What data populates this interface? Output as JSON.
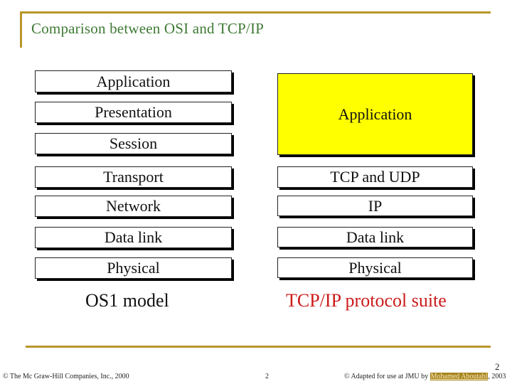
{
  "slide": {
    "title": "Comparison between OSI and TCP/IP",
    "page_number": "2"
  },
  "colors": {
    "accent_gold": "#b8962a",
    "title_green": "#3f7a35",
    "highlight_yellow": "#ffff00",
    "tcp_caption_red": "#cc1a1a"
  },
  "osi": {
    "caption": "OS1 model",
    "layers": [
      {
        "label": "Application"
      },
      {
        "label": "Presentation"
      },
      {
        "label": "Session"
      },
      {
        "label": "Transport"
      },
      {
        "label": "Network"
      },
      {
        "label": "Data link"
      },
      {
        "label": "Physical"
      }
    ]
  },
  "tcpip": {
    "caption": "TCP/IP protocol suite",
    "layers": [
      {
        "label": "Application",
        "spans_osi_layers": [
          "Application",
          "Presentation",
          "Session"
        ]
      },
      {
        "label": "TCP and  UDP",
        "spans_osi_layers": [
          "Transport"
        ]
      },
      {
        "label": "IP",
        "spans_osi_layers": [
          "Network"
        ]
      },
      {
        "label": "Data link",
        "spans_osi_layers": [
          "Data link"
        ]
      },
      {
        "label": "Physical",
        "spans_osi_layers": [
          "Physical"
        ]
      }
    ]
  },
  "footer": {
    "copyright_left": "© The Mc Graw-Hill Companies, Inc., 2000",
    "center_number": "2",
    "adapted_prefix": "© Adapted for use at JMU by ",
    "author_link": "Mohamed Aboutabl",
    "adapted_suffix": ", 2003"
  }
}
